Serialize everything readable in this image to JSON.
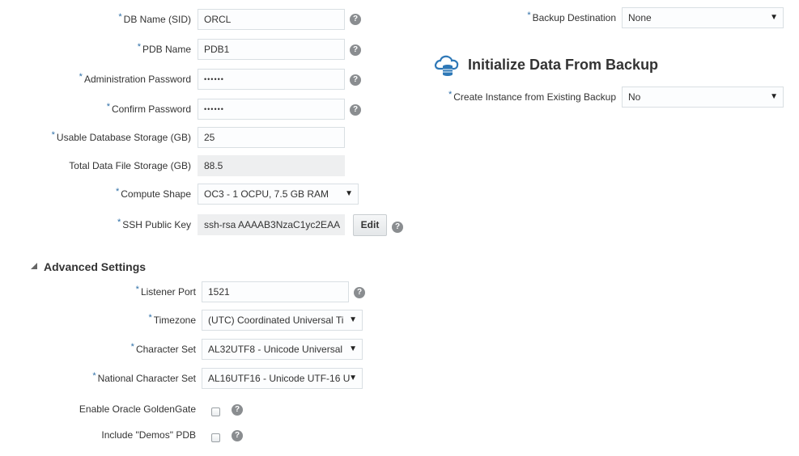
{
  "form": {
    "db_name": {
      "label": "DB Name (SID)",
      "value": "ORCL"
    },
    "pdb_name": {
      "label": "PDB Name",
      "value": "PDB1"
    },
    "admin_password": {
      "label": "Administration Password",
      "value": "••••••"
    },
    "confirm_password": {
      "label": "Confirm Password",
      "value": "••••••"
    },
    "usable_storage": {
      "label": "Usable Database Storage (GB)",
      "value": "25"
    },
    "total_storage": {
      "label": "Total Data File Storage (GB)",
      "value": "88.5"
    },
    "compute_shape": {
      "label": "Compute Shape",
      "value": "OC3 - 1 OCPU, 7.5 GB RAM"
    },
    "ssh_key": {
      "label": "SSH Public Key",
      "value": "ssh-rsa AAAAB3NzaC1yc2EAA",
      "edit_label": "Edit"
    }
  },
  "advanced": {
    "title": "Advanced Settings",
    "listener_port": {
      "label": "Listener Port",
      "value": "1521"
    },
    "timezone": {
      "label": "Timezone",
      "value": "(UTC) Coordinated Universal Ti"
    },
    "charset": {
      "label": "Character Set",
      "value": "AL32UTF8 - Unicode Universal"
    },
    "national_charset": {
      "label": "National Character Set",
      "value": "AL16UTF16 - Unicode UTF-16 U"
    },
    "goldengate": {
      "label": "Enable Oracle GoldenGate",
      "checked": false
    },
    "demos_pdb": {
      "label": "Include \"Demos\" PDB",
      "checked": false
    }
  },
  "backup": {
    "destination": {
      "label": "Backup Destination",
      "value": "None"
    },
    "init_title": "Initialize Data From Backup",
    "create_from_backup": {
      "label": "Create Instance from Existing Backup",
      "value": "No"
    }
  },
  "common": {
    "required_mark": "*",
    "help_glyph": "?",
    "dropdown_glyph": "▼"
  },
  "colors": {
    "required": "#2e6fa7",
    "help_icon": "#8a8d90",
    "cloud_icon": "#2e78b7"
  }
}
